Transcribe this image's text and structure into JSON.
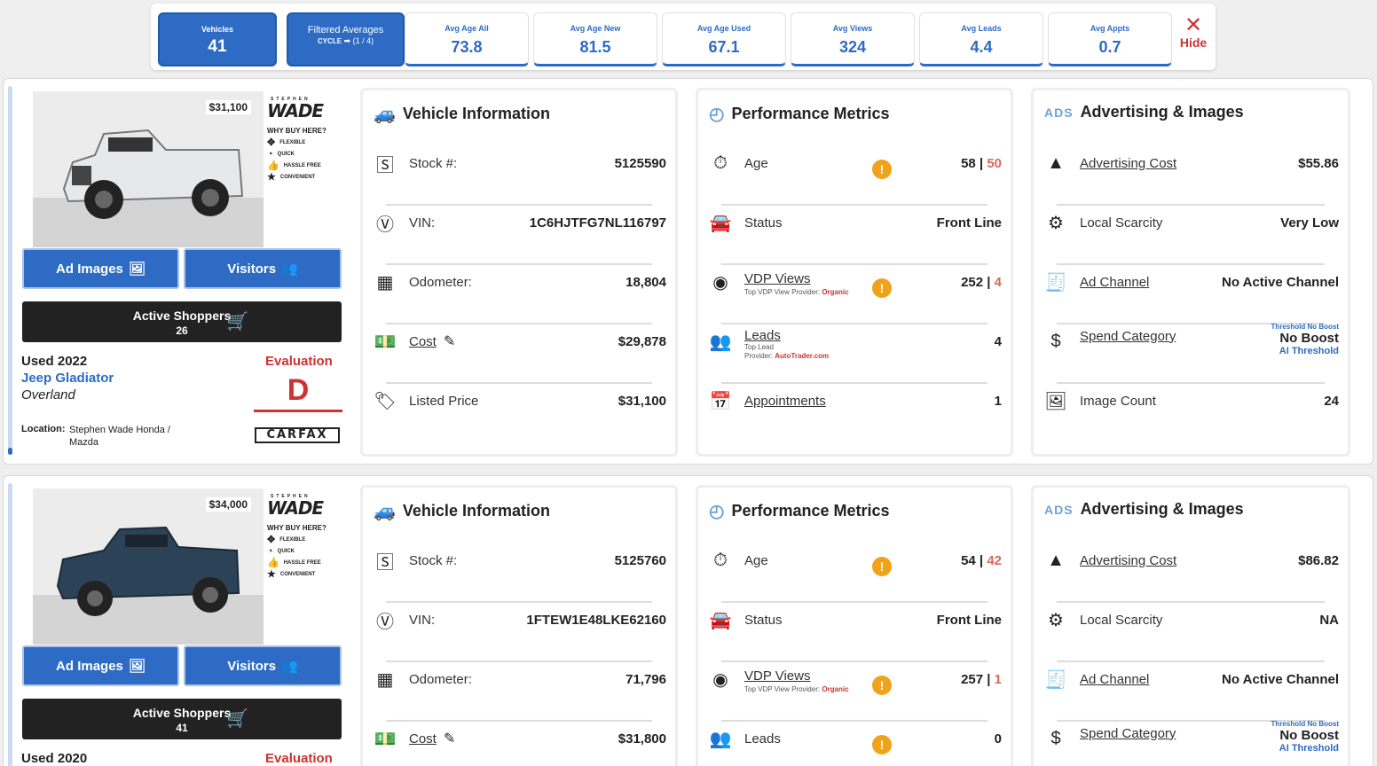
{
  "summary": {
    "vehicles_label": "Vehicles",
    "vehicles_value": "41",
    "filtered_label": "Filtered Averages",
    "filtered_cycle": "CYCLE",
    "filtered_page": "(1 / 4)",
    "stats": [
      {
        "label": "Avg Age All",
        "value": "73.8"
      },
      {
        "label": "Avg Age New",
        "value": "81.5"
      },
      {
        "label": "Avg Age Used",
        "value": "67.1"
      },
      {
        "label": "Avg Views",
        "value": "324"
      },
      {
        "label": "Avg Leads",
        "value": "4.4"
      },
      {
        "label": "Avg Appts",
        "value": "0.7"
      }
    ],
    "hide_label": "Hide"
  },
  "dealer": {
    "name": "WADE",
    "top": "STEPHEN",
    "why": "WHY BUY HERE?",
    "perks": [
      "FLEXIBLE",
      "QUICK",
      "HASSLE FREE",
      "CONVENIENT"
    ]
  },
  "labels": {
    "ad_images": "Ad Images",
    "visitors": "Visitors",
    "active_shoppers": "Active Shoppers",
    "evaluation": "Evaluation",
    "location": "Location:",
    "carfax": "CARFAX",
    "vehicle_info": "Vehicle Information",
    "performance": "Performance Metrics",
    "ads_prefix": "ADS",
    "advertising": "Advertising & Images",
    "stock": "Stock #:",
    "vin": "VIN:",
    "odometer": "Odometer:",
    "cost": "Cost",
    "listed_price": "Listed Price",
    "age": "Age",
    "status": "Status",
    "vdp_views": "VDP Views",
    "vdp_sub": "Top VDP View Provider:",
    "leads": "Leads",
    "leads_sub1": "Top Lead",
    "leads_sub2": "Provider:",
    "appointments": "Appointments",
    "ad_cost": "Advertising Cost",
    "scarcity": "Local Scarcity",
    "ad_channel": "Ad Channel",
    "spend": "Spend Category",
    "image_count": "Image Count",
    "threshold_top": "Threshold No Boost",
    "threshold_bottom": "AI Threshold"
  },
  "vehicles": [
    {
      "price_tag": "$31,100",
      "shoppers": "26",
      "year": "Used 2022",
      "model": "Jeep Gladiator",
      "trim": "Overland",
      "grade": "D",
      "location": "Stephen Wade Honda / Mazda",
      "stock": "5125590",
      "vin": "1C6HJTFG7NL116797",
      "odometer": "18,804",
      "cost": "$29,878",
      "listed": "$31,100",
      "age": "58",
      "age2": "50",
      "status": "Front Line",
      "vdp": "252",
      "vdp2": "4",
      "vdp_provider": "Organic",
      "leads": "4",
      "lead_provider": "AutoTrader.com",
      "appts": "1",
      "ad_cost": "$55.86",
      "scarcity": "Very Low",
      "channel": "No Active Channel",
      "spend": "No Boost",
      "images": "24",
      "color": "#e6e8ea"
    },
    {
      "price_tag": "$34,000",
      "shoppers": "41",
      "year": "Used 2020",
      "stock": "5125760",
      "vin": "1FTEW1E48LKE62160",
      "odometer": "71,796",
      "cost": "$31,800",
      "age": "54",
      "age2": "42",
      "status": "Front Line",
      "vdp": "257",
      "vdp2": "1",
      "vdp_provider": "Organic",
      "leads": "0",
      "ad_cost": "$86.82",
      "scarcity": "NA",
      "channel": "No Active Channel",
      "spend": "No Boost",
      "color": "#2c4357"
    }
  ]
}
